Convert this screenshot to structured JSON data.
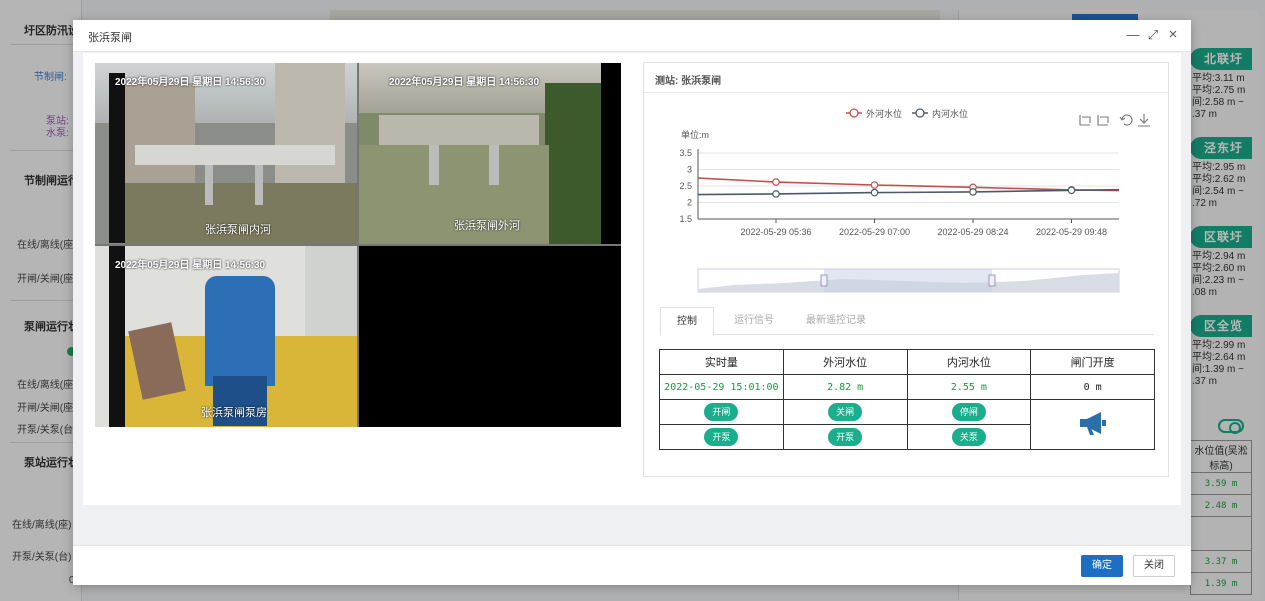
{
  "background": {
    "left_panel": {
      "section_title": "圩区防汛设",
      "gate_label": "节制闸:",
      "pump_label": "泵站:",
      "pump2_label": "水泵:",
      "gate_status_title": "节制闸运行",
      "online_offline": "在线/离线(座)",
      "open_close_gate": "开闸/关闸(座)",
      "pump_gate_status_title": "泵闸运行状",
      "online_offline_2": "在线/离线(座)",
      "open_close_gate_2": "开闸/关闸(座)",
      "pump_onoff": "开泵/关泵(台)",
      "pump_station_title": "泵站运行状",
      "online_offline_3": "在线/离线(座)",
      "pump_onoff_2": "开泵/关泵(台)",
      "zero": "0"
    },
    "right_cards": [
      {
        "name": "北联圩",
        "l1": "平均:3.11 m",
        "l2": "平均:2.75 m",
        "l3": "间:2.58 m ~",
        "l4": ".37 m"
      },
      {
        "name": "泾东圩",
        "l1": "平均:2.95 m",
        "l2": "平均:2.62 m",
        "l3": "间:2.54 m ~",
        "l4": ".72 m"
      },
      {
        "name": "区联圩",
        "l1": "平均:2.94 m",
        "l2": "平均:2.60 m",
        "l3": "间:2.23 m ~",
        "l4": ".08 m"
      },
      {
        "name": "区全览",
        "l1": "平均:2.99 m",
        "l2": "平均:2.64 m",
        "l3": "间:1.39 m ~",
        "l4": ".37 m"
      }
    ],
    "right_table": {
      "header": "水位值(吴淞标高)",
      "values": [
        "3.59 m",
        "2.48 m",
        "",
        "3.37 m",
        "1.39 m"
      ]
    }
  },
  "modal": {
    "title": "张浜泵闸",
    "minimize_icon": "—",
    "maximize_icon": "⤢",
    "close_icon": "×",
    "ok_label": "确定",
    "close_label": "关闭"
  },
  "videos": [
    {
      "osd": "2022年05月29日  星期日  14:56:30",
      "caption": "张浜泵闸内河"
    },
    {
      "osd": "2022年05月29日  星期日  14:56:30",
      "caption": "张浜泵闸外河"
    },
    {
      "osd": "2022年05月29日  星期日  14:56:30",
      "caption": "张浜泵闸泵房"
    },
    {
      "osd": "",
      "caption": ""
    }
  ],
  "panel": {
    "title": "测站: 张浜泵闸",
    "tabs": [
      "控制",
      "运行信号",
      "最新遥控记录"
    ],
    "active_tab": 0
  },
  "control_table": {
    "headers": [
      "实时量",
      "外河水位",
      "内河水位",
      "闸门开度"
    ],
    "values": [
      "2022-05-29 15:01:00",
      "2.82 m",
      "2.55 m",
      "0 m"
    ],
    "buttons_row1": [
      "开闸",
      "关闸",
      "停闸"
    ],
    "buttons_row2": [
      "开泵",
      "开泵",
      "关泵"
    ],
    "alarm_icon": "megaphone-icon"
  },
  "chart_data": {
    "type": "line",
    "unit_label": "单位:m",
    "x": [
      "2022-05-29 05:36",
      "2022-05-29 07:00",
      "2022-05-29 08:24",
      "2022-05-29 09:48"
    ],
    "x_tick_labels": [
      "2022-05-29 05:36",
      "2022-05-29 07:00",
      "2022-05-29 08:24",
      "2022-05-29 09:48"
    ],
    "y_ticks": [
      "1.5",
      "2",
      "2.5",
      "3",
      "3.5"
    ],
    "ylim": [
      1.5,
      3.5
    ],
    "series": [
      {
        "name": "外河水位",
        "color": "#c0504d",
        "values": [
          2.62,
          2.53,
          2.46,
          2.38
        ]
      },
      {
        "name": "内河水位",
        "color": "#4a5a6a",
        "values": [
          2.26,
          2.3,
          2.32,
          2.37
        ]
      }
    ],
    "legend_position": "top",
    "toolbox_icons": [
      "zoom-icon",
      "zoom-reset-icon",
      "restore-icon",
      "download-icon"
    ],
    "grid": true,
    "has_datazoom": true
  }
}
